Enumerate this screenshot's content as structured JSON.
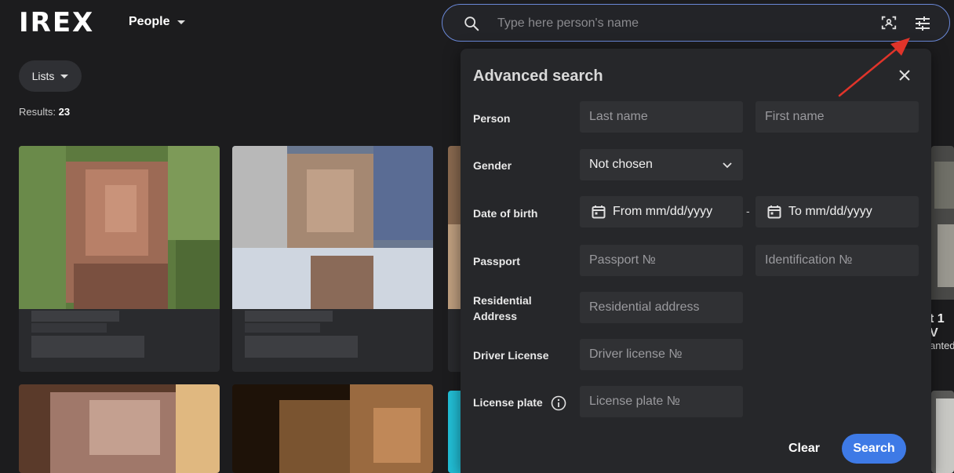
{
  "header": {
    "logo": "IREX",
    "nav_label": "People",
    "search_placeholder": "Type here person's name"
  },
  "toolbar": {
    "lists_label": "Lists",
    "results_label": "Results:",
    "results_count": "23"
  },
  "side_text": {
    "line1": "t 1 V",
    "line2": "anted"
  },
  "advanced_search": {
    "title": "Advanced search",
    "labels": {
      "person": "Person",
      "gender": "Gender",
      "dob": "Date of birth",
      "passport": "Passport",
      "residential_line1": "Residential",
      "residential_line2": "Address",
      "driver_license": "Driver License",
      "license_plate": "License plate"
    },
    "placeholders": {
      "last_name": "Last name",
      "first_name": "First name",
      "passport_no": "Passport №",
      "identification_no": "Identification №",
      "residential_address": "Residential address",
      "driver_license_no": "Driver license №",
      "license_plate_no": "License plate №"
    },
    "gender_value": "Not chosen",
    "dob_from": "From mm/dd/yyyy",
    "dob_separator": "-",
    "dob_to": "To mm/dd/yyyy",
    "clear_label": "Clear",
    "search_label": "Search"
  },
  "colors": {
    "background": "#1c1c1e",
    "panel": "#26272a",
    "field": "#303134",
    "accent": "#3e7ae6",
    "annotation_arrow": "#e0342a"
  }
}
